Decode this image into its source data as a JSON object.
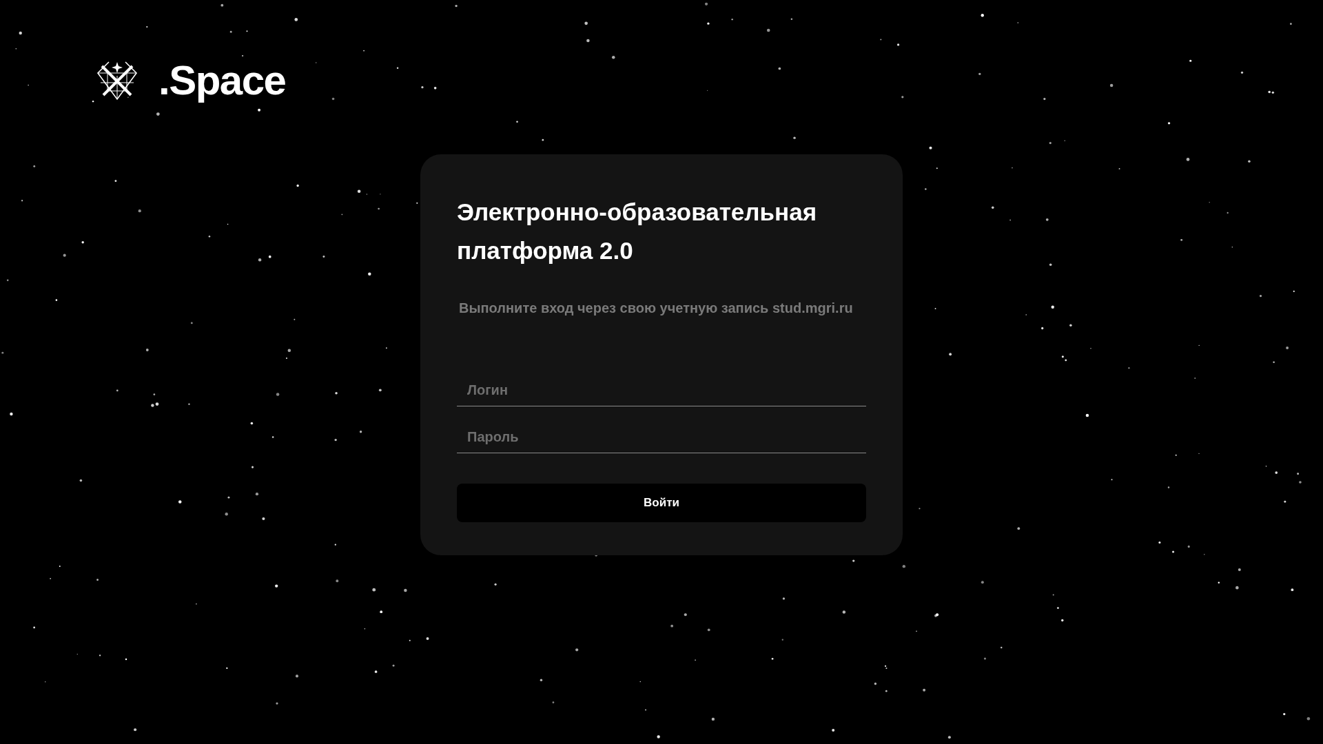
{
  "logo": {
    "text": ".Space"
  },
  "login_card": {
    "title": "Электронно-образовательная платформа 2.0",
    "subtitle": "Выполните вход через свою учетную запись stud.mgri.ru",
    "fields": [
      {
        "placeholder": "Логин"
      },
      {
        "placeholder": "Пароль"
      }
    ],
    "submit_button": "Войти"
  }
}
